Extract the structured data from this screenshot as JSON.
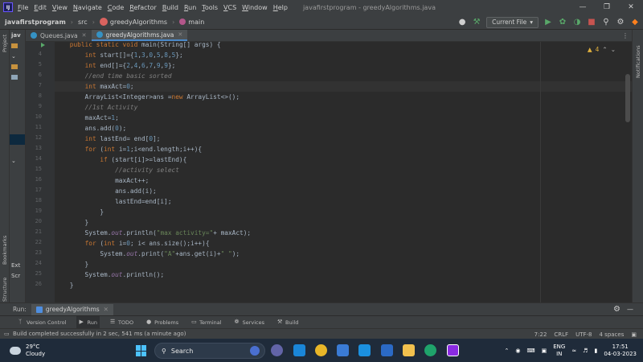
{
  "menubar": {
    "items": [
      "File",
      "Edit",
      "View",
      "Navigate",
      "Code",
      "Refactor",
      "Build",
      "Run",
      "Tools",
      "VCS",
      "Window",
      "Help"
    ],
    "window_title": "javafirstprogram - greedyAlgorithms.java"
  },
  "navbar": {
    "project": "javafirstprogram",
    "src": "src",
    "class": "greedyAlgorithms",
    "method": "main",
    "run_config": "Current File"
  },
  "side": {
    "project_label": "Project",
    "notifications_label": "Notifications",
    "bookmarks_label": "Bookmarks",
    "structure_label": "Structure",
    "project_rows": [
      "jav",
      "",
      "",
      "",
      "",
      "",
      "",
      "",
      "",
      "",
      "",
      "Ext",
      "Scr"
    ]
  },
  "tabs": [
    {
      "label": "Queues.java",
      "active": false
    },
    {
      "label": "greedyAlgorithms.java",
      "active": true
    }
  ],
  "editor": {
    "warnings": "4",
    "caret_line": 7,
    "lines": [
      {
        "n": "",
        "code": "    public static void main(String[] args) {"
      },
      {
        "n": "4",
        "code": "        int start[]={1,3,0,5,8,5};"
      },
      {
        "n": "5",
        "code": "        int end[]={2,4,6,7,9,9};"
      },
      {
        "n": "6",
        "code": "        //end time basic sorted"
      },
      {
        "n": "7",
        "code": "        int maxAct=0;"
      },
      {
        "n": "8",
        "code": "        ArrayList<Integer>ans =new ArrayList<>();"
      },
      {
        "n": "9",
        "code": "        //1st Activity"
      },
      {
        "n": "10",
        "code": "        maxAct=1;"
      },
      {
        "n": "11",
        "code": "        ans.add(0);"
      },
      {
        "n": "12",
        "code": "        int lastEnd= end[0];"
      },
      {
        "n": "13",
        "code": "        for (int i=1;i<end.length;i++){"
      },
      {
        "n": "14",
        "code": "            if (start[i]>=lastEnd){"
      },
      {
        "n": "15",
        "code": "                //activity select"
      },
      {
        "n": "16",
        "code": "                maxAct++;"
      },
      {
        "n": "17",
        "code": "                ans.add(i);"
      },
      {
        "n": "18",
        "code": "                lastEnd=end[i];"
      },
      {
        "n": "19",
        "code": "            }"
      },
      {
        "n": "20",
        "code": "        }"
      },
      {
        "n": "21",
        "code": "        System.out.println(\"max activity=\"+ maxAct);"
      },
      {
        "n": "22",
        "code": "        for (int i=0; i< ans.size();i++){"
      },
      {
        "n": "23",
        "code": "            System.out.print(\"A\"+ans.get(i)+\" \");"
      },
      {
        "n": "24",
        "code": "        }"
      },
      {
        "n": "25",
        "code": "        System.out.println();"
      },
      {
        "n": "26",
        "code": "    }"
      }
    ]
  },
  "runbar": {
    "label": "Run:",
    "tab": "greedyAlgorithms"
  },
  "toolwindows": [
    "Version Control",
    "Run",
    "TODO",
    "Problems",
    "Terminal",
    "Services",
    "Build"
  ],
  "status": {
    "message": "Build completed successfully in 2 sec, 541 ms (a minute ago)",
    "position": "7:22",
    "line_sep": "CRLF",
    "encoding": "UTF-8",
    "indent": "4 spaces"
  },
  "taskbar": {
    "temp": "29°C",
    "weather": "Cloudy",
    "search": "Search",
    "lang1": "ENG",
    "lang2": "IN",
    "time": "17:51",
    "date": "04-03-2023"
  },
  "colors": {
    "keyword": "#cc7832",
    "number": "#6897bb",
    "string": "#6a8759",
    "comment": "#808080",
    "field": "#9876aa",
    "accent": "#4a88c7"
  }
}
